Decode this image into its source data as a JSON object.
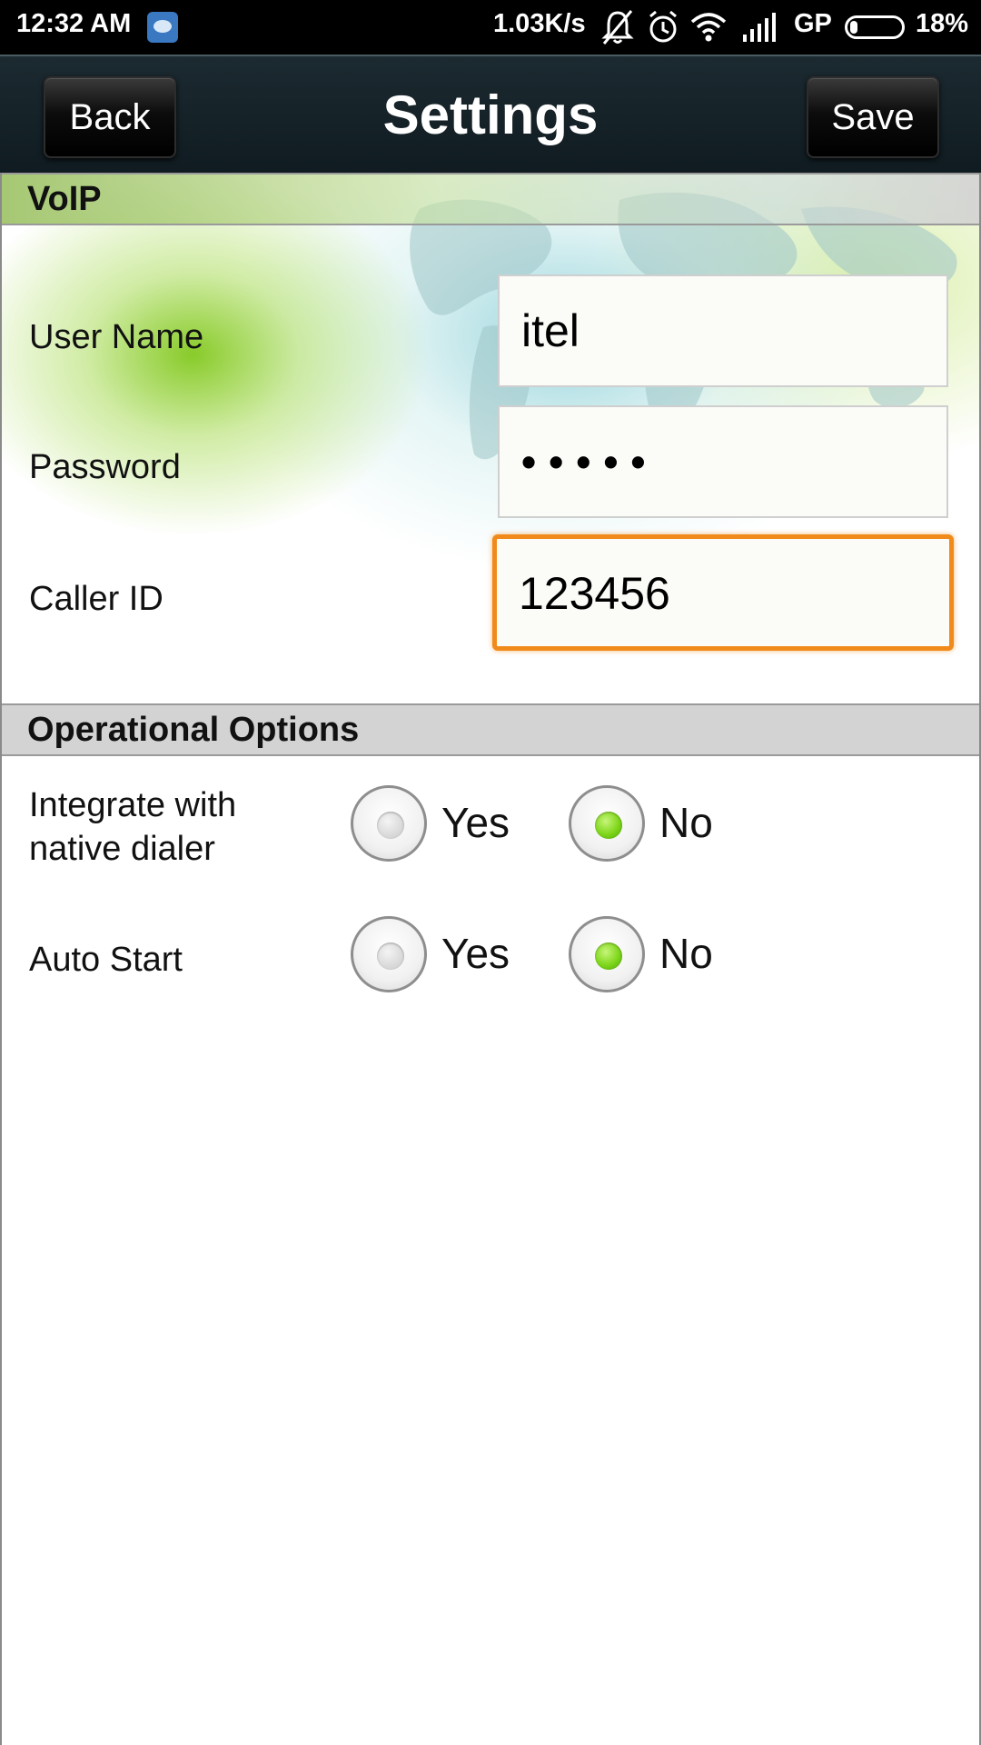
{
  "status_bar": {
    "time": "12:32 AM",
    "net_speed": "1.03K/s",
    "carrier": "GP",
    "battery": "18%",
    "battery_level": 0.18,
    "icons": [
      "app-notification-icon",
      "bell-muted-icon",
      "alarm-icon",
      "wifi-icon",
      "signal-icon",
      "battery-icon"
    ]
  },
  "header": {
    "title": "Settings",
    "back_label": "Back",
    "save_label": "Save"
  },
  "voip": {
    "title": "VoIP",
    "user_name_label": "User Name",
    "user_name_value": "itel",
    "password_label": "Password",
    "password_value": "•••••",
    "caller_id_label": "Caller ID",
    "caller_id_value": "123456"
  },
  "operational": {
    "title": "Operational Options",
    "integrate_label_line1": "Integrate with",
    "integrate_label_line2": "native dialer",
    "integrate_selected": "No",
    "auto_start_label": "Auto Start",
    "auto_start_selected": "No",
    "yes_label": "Yes",
    "no_label": "No"
  },
  "colors": {
    "focus_border": "#f08a1a",
    "radio_selected": "#7ed61a",
    "title_bar": "#0f1b20"
  }
}
